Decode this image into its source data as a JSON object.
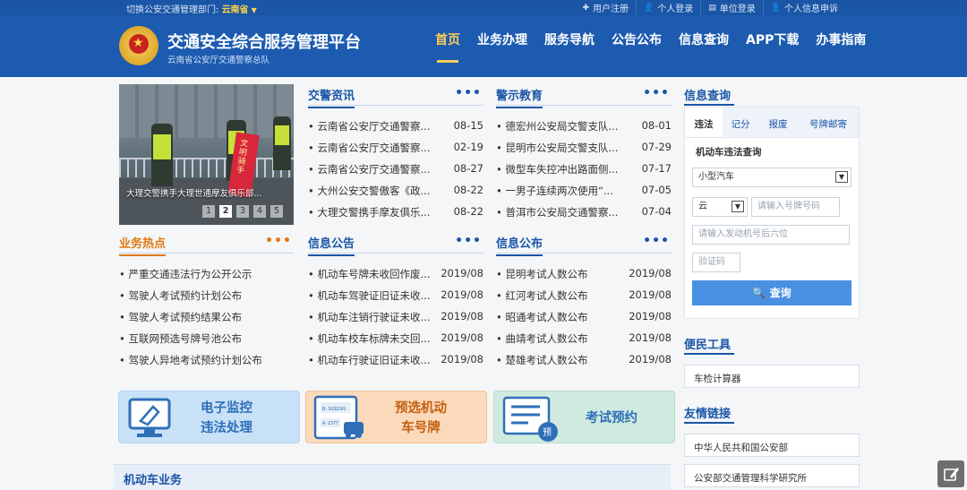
{
  "topbar": {
    "switch_label": "切换公安交通管理部门:",
    "province": "云南省",
    "links": [
      {
        "icon": "plus-icon",
        "label": "用户注册"
      },
      {
        "icon": "user-icon",
        "label": "个人登录"
      },
      {
        "icon": "document-icon",
        "label": "单位登录"
      },
      {
        "icon": "user-icon",
        "label": "个人信息申诉"
      }
    ]
  },
  "header": {
    "title": "交通安全综合服务管理平台",
    "subtitle": "云南省公安厅交通警察总队",
    "nav": [
      "首页",
      "业务办理",
      "服务导航",
      "公告公布",
      "信息查询",
      "APP下载",
      "办事指南"
    ],
    "active_nav": "首页"
  },
  "carousel": {
    "caption": "大理交警携手大理世通摩友俱乐部...",
    "flag_text": "文明骑手",
    "pages": [
      "1",
      "2",
      "3",
      "4",
      "5"
    ],
    "current_page": "2"
  },
  "news": {
    "title": "交警资讯",
    "more": "•••",
    "items": [
      {
        "title": "• 云南省公安厅交通警察...",
        "date": "08-15"
      },
      {
        "title": "• 云南省公安厅交通警察...",
        "date": "02-19"
      },
      {
        "title": "• 云南省公安厅交通警察...",
        "date": "08-27"
      },
      {
        "title": "• 大州公安交警傲客《政...",
        "date": "08-22"
      },
      {
        "title": "• 大理交警携手摩友俱乐...",
        "date": "08-22"
      }
    ]
  },
  "education": {
    "title": "警示教育",
    "more": "•••",
    "items": [
      {
        "title": "• 德宏州公安局交警支队...",
        "date": "08-01"
      },
      {
        "title": "• 昆明市公安局交警支队...",
        "date": "07-29"
      },
      {
        "title": "• 微型车失控冲出路面侧...",
        "date": "07-17"
      },
      {
        "title": "• 一男子连续两次使用“...",
        "date": "07-05"
      },
      {
        "title": "• 普洱市公安局交通警察...",
        "date": "07-04"
      }
    ]
  },
  "hot": {
    "title": "业务热点",
    "more": "•••",
    "items": [
      "• 严重交通违法行为公开公示",
      "• 驾驶人考试预约计划公布",
      "• 驾驶人考试预约结果公布",
      "• 互联网预选号牌号池公布",
      "• 驾驶人异地考试预约计划公布"
    ]
  },
  "notice": {
    "title": "信息公告",
    "more": "•••",
    "items": [
      {
        "title": "• 机动车号牌未收回作废...",
        "date": "2019/08"
      },
      {
        "title": "• 机动车驾驶证旧证未收...",
        "date": "2019/08"
      },
      {
        "title": "• 机动车注销行驶证未收...",
        "date": "2019/08"
      },
      {
        "title": "• 机动车校车标牌未交回...",
        "date": "2019/08"
      },
      {
        "title": "• 机动车行驶证旧证未收...",
        "date": "2019/08"
      }
    ]
  },
  "publish": {
    "title": "信息公布",
    "more": "•••",
    "items": [
      {
        "title": "• 昆明考试人数公布",
        "date": "2019/08"
      },
      {
        "title": "• 红河考试人数公布",
        "date": "2019/08"
      },
      {
        "title": "• 昭通考试人数公布",
        "date": "2019/08"
      },
      {
        "title": "• 曲靖考试人数公布",
        "date": "2019/08"
      },
      {
        "title": "• 楚雄考试人数公布",
        "date": "2019/08"
      }
    ]
  },
  "tiles": [
    {
      "line1": "电子监控",
      "line2": "违法处理",
      "icon": "monitor-icon"
    },
    {
      "line1": "预选机动",
      "line2": "车号牌",
      "icon": "license-plate-icon",
      "plate_top": "B·92829S",
      "plate_bottom": "A·2377"
    },
    {
      "line1": "考试预约",
      "icon": "exam-icon",
      "badge": "预"
    }
  ],
  "query": {
    "title": "信息查询",
    "tabs": [
      "违法",
      "记分",
      "报废",
      "号牌邮寄"
    ],
    "active_tab": "违法",
    "section_label": "机动车违法查询",
    "vehicle_type": "小型汽车",
    "province_short": "云",
    "plate_placeholder": "请输入号牌号码",
    "engine_placeholder": "请输入发动机号后六位",
    "captcha_placeholder": "验证码",
    "submit_label": "查询"
  },
  "services": {
    "title": "便民工具",
    "items": [
      "车检计算器"
    ]
  },
  "links": {
    "title": "友情链接",
    "items": [
      "中华人民共和国公安部",
      "公安部交通管理科学研究所"
    ]
  },
  "bottom": {
    "section_title": "机动车业务"
  },
  "colors": {
    "header_blue": "#1c5bb0",
    "accent_gold": "#ffce5a",
    "hot_orange": "#e07a12",
    "button_blue": "#4a90e2"
  }
}
